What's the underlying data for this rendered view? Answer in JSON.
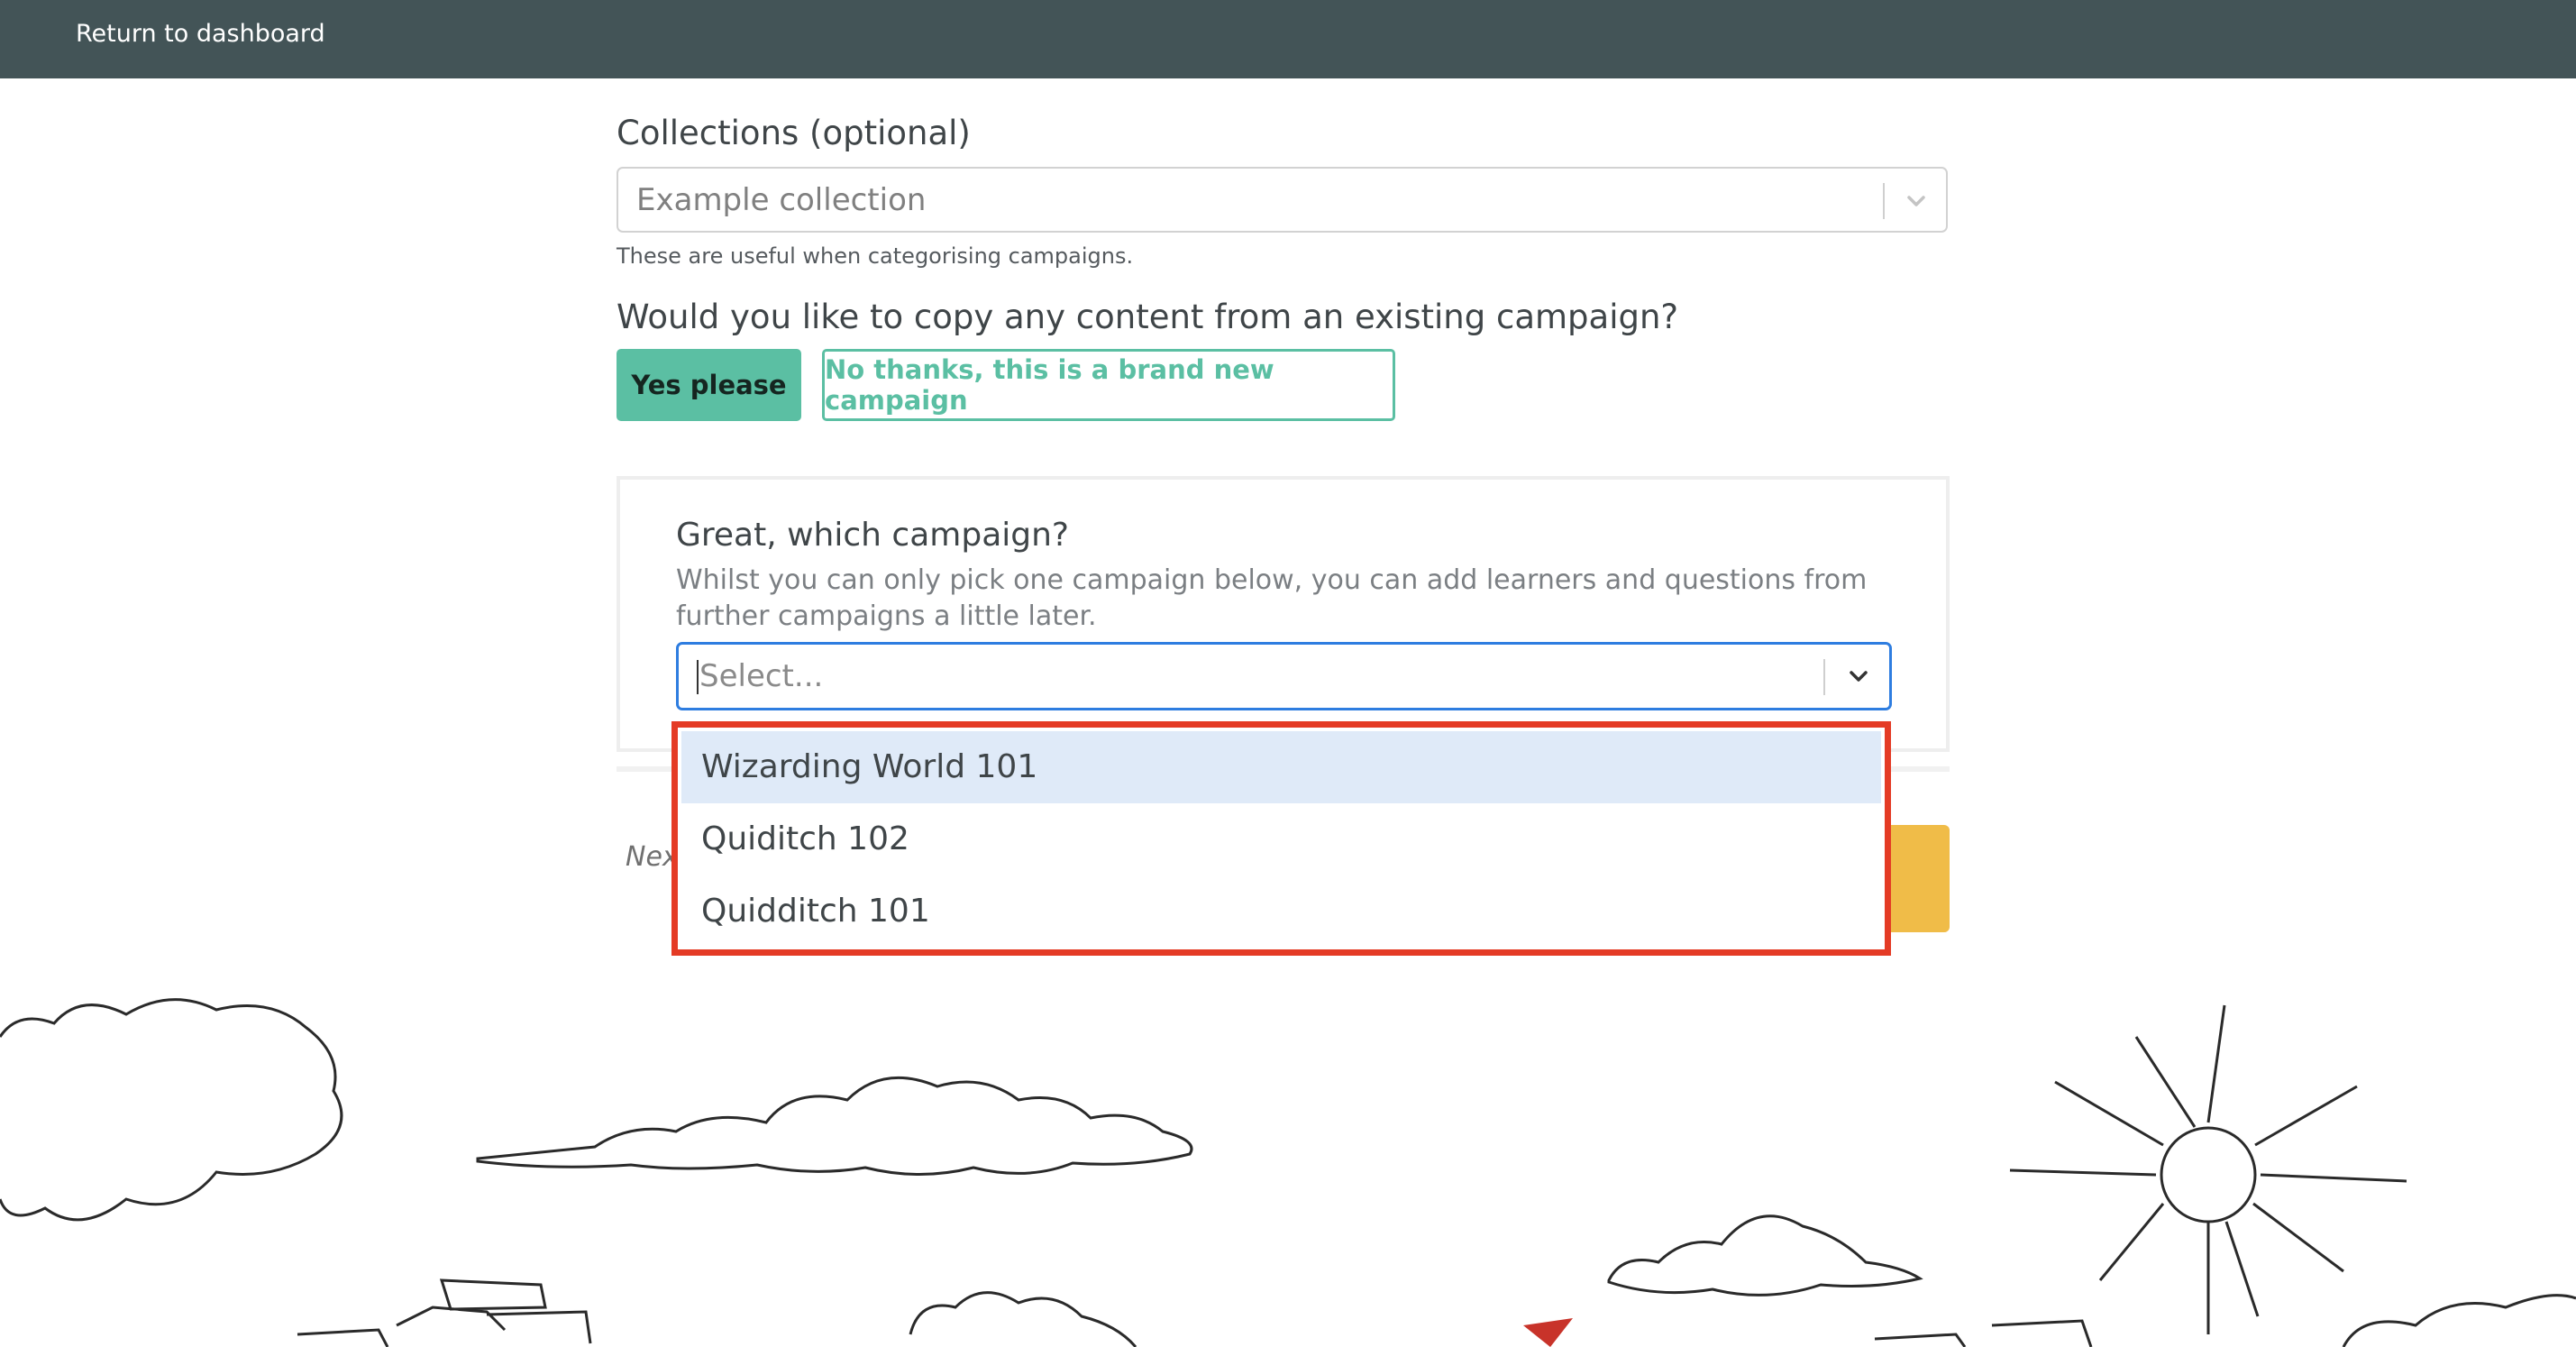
{
  "topbar": {
    "return_link": "Return to dashboard"
  },
  "collections": {
    "label": "Collections (optional)",
    "placeholder": "Example collection",
    "help": "These are useful when categorising campaigns."
  },
  "copy_question": {
    "label": "Would you like to copy any content from an existing campaign?",
    "yes_label": "Yes please",
    "no_label": "No thanks, this is a brand new campaign"
  },
  "campaign_picker": {
    "title": "Great, which campaign?",
    "description": "Whilst you can only pick one campaign below, you can add learners and questions from further campaigns a little later.",
    "placeholder": "Select...",
    "options": [
      "Wizarding World 101",
      "Quiditch 102",
      "Quidditch 101"
    ],
    "highlighted_option": "Wizarding World 101"
  },
  "footer": {
    "partial_text": "Nex"
  },
  "colors": {
    "topbar": "#435457",
    "accent": "#5bbfa3",
    "focus": "#2e7de0",
    "highlight": "#e43b25",
    "option_hover": "#dfeaf8",
    "cta": "#f0bc48"
  },
  "icons": [
    "chevron-down-icon",
    "chevron-down-icon"
  ]
}
